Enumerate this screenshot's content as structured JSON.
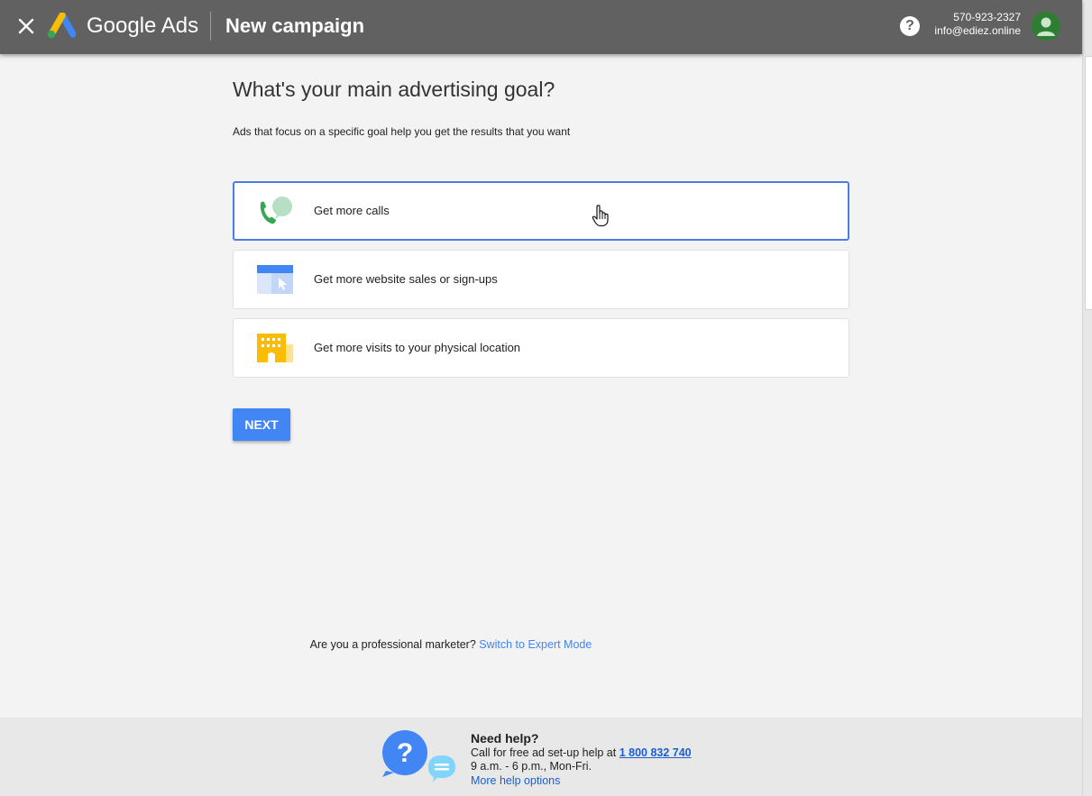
{
  "header": {
    "brand": "Google Ads",
    "title": "New campaign",
    "help_symbol": "?",
    "account_phone": "570-923-2327",
    "account_email": "info@ediez.online"
  },
  "main": {
    "heading": "What's your main advertising goal?",
    "subheading": "Ads that focus on a specific goal help you get the results that you want",
    "goals": [
      {
        "label": "Get more calls",
        "icon": "phone-call-icon",
        "selected": true
      },
      {
        "label": "Get more website sales or sign-ups",
        "icon": "website-icon",
        "selected": false
      },
      {
        "label": "Get more visits to your physical location",
        "icon": "building-icon",
        "selected": false
      }
    ],
    "next_label": "NEXT",
    "expert_prompt": "Are you a professional marketer?",
    "expert_link": "Switch to Expert Mode"
  },
  "footer": {
    "title": "Need help?",
    "call_text": "Call for free ad set-up help at",
    "phone": "1 800 832 740",
    "hours": "9 a.m. - 6 p.m., Mon-Fri.",
    "more_link": "More help options"
  },
  "colors": {
    "accent": "#4285f4",
    "topbar": "#616161",
    "selected_border": "#4a7ee6",
    "link": "#1a5fd1"
  }
}
